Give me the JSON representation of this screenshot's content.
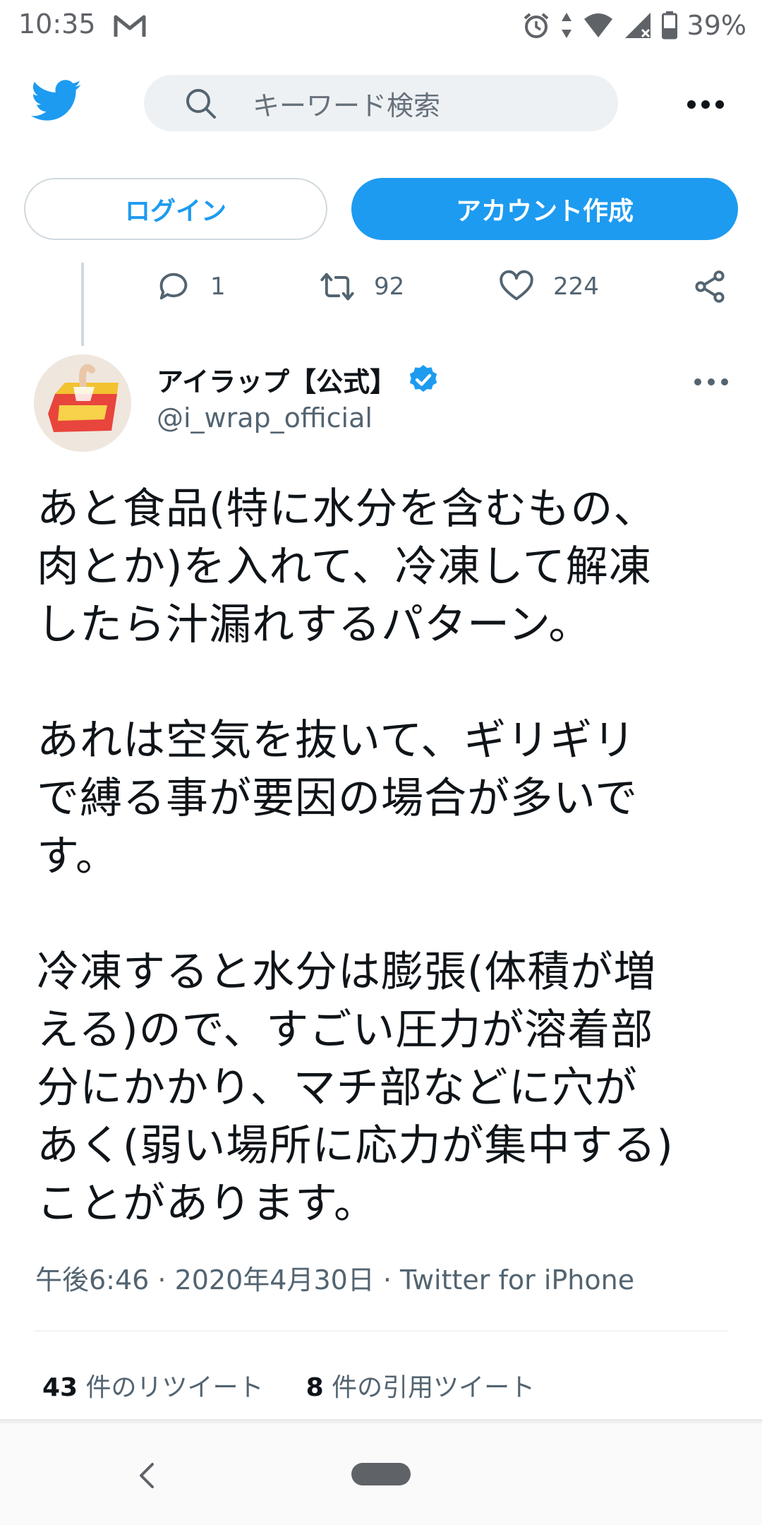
{
  "status_bar": {
    "time": "10:35",
    "notification_icons": [
      "gmail-icon"
    ],
    "system_icons": [
      "alarm-icon",
      "data-arrows-icon",
      "wifi-icon",
      "signal-icon",
      "battery-icon"
    ],
    "battery": "39%"
  },
  "header": {
    "logo": "twitter-bird-icon",
    "search_placeholder": "キーワード検索",
    "more_icon": "more-horizontal-icon"
  },
  "auth": {
    "login_label": "ログイン",
    "signup_label": "アカウント作成"
  },
  "prev_tweet_actions": {
    "reply_count": "1",
    "retweet_count": "92",
    "like_count": "224"
  },
  "tweet": {
    "author_name": "アイラップ【公式】",
    "author_handle": "@i_wrap_official",
    "verified": true,
    "text": "あと食品(特に水分を含むもの、\n肉とか)を入れて、冷凍して解凍\nしたら汁漏れするパターン。\n\nあれは空気を抜いて、ギリギリ\nで縛る事が要因の場合が多いで\nす。\n\n冷凍すると水分は膨張(体積が増\nえる)ので、すごい圧力が溶着部\n分にかかり、マチ部などに穴が\nあく(弱い場所に応力が集中する)\nことがあります。",
    "meta": "午後6:46 · 2020年4月30日 · Twitter for iPhone",
    "retweets_num": "43",
    "retweets_label": " 件のリツイート",
    "quotes_num": "8",
    "quotes_label": " 件の引用ツイート"
  },
  "colors": {
    "brand_blue": "#1d9bf0",
    "text_primary": "#0f1419",
    "text_secondary": "#536471"
  }
}
